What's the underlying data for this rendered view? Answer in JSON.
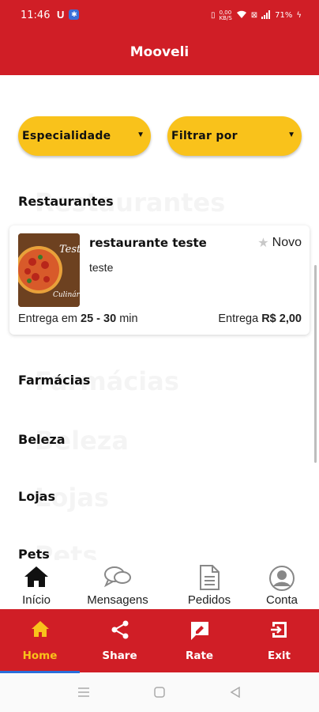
{
  "status_bar": {
    "time": "11:46",
    "battery": "71%"
  },
  "app": {
    "title": "Mooveli"
  },
  "filters": {
    "specialty_label": "Especialidade",
    "filter_label": "Filtrar por"
  },
  "sections": {
    "restaurants": "Restaurantes",
    "pharmacies": "Farmácias",
    "beauty": "Beleza",
    "stores": "Lojas",
    "pets": "Pets"
  },
  "restaurant_card": {
    "name": "restaurante teste",
    "description": "teste",
    "badge": "Novo",
    "delivery_time_prefix": "Entrega em",
    "delivery_time_value": "25 - 30",
    "delivery_time_unit": "min",
    "delivery_fee_prefix": "Entrega",
    "delivery_fee_value": "R$ 2,00",
    "image_text_top": "Teste",
    "image_text_bottom": "Culinária"
  },
  "tabs": [
    {
      "label": "Início",
      "icon": "home-icon"
    },
    {
      "label": "Mensagens",
      "icon": "chat-icon"
    },
    {
      "label": "Pedidos",
      "icon": "document-icon"
    },
    {
      "label": "Conta",
      "icon": "account-icon"
    }
  ],
  "bottom_bar": [
    {
      "label": "Home",
      "icon": "home-icon",
      "active": true
    },
    {
      "label": "Share",
      "icon": "share-icon"
    },
    {
      "label": "Rate",
      "icon": "rate-icon"
    },
    {
      "label": "Exit",
      "icon": "exit-icon"
    }
  ],
  "colors": {
    "primary_red": "#d01e26",
    "accent_yellow": "#f9c21b",
    "active_indicator": "#2a6fdb"
  }
}
